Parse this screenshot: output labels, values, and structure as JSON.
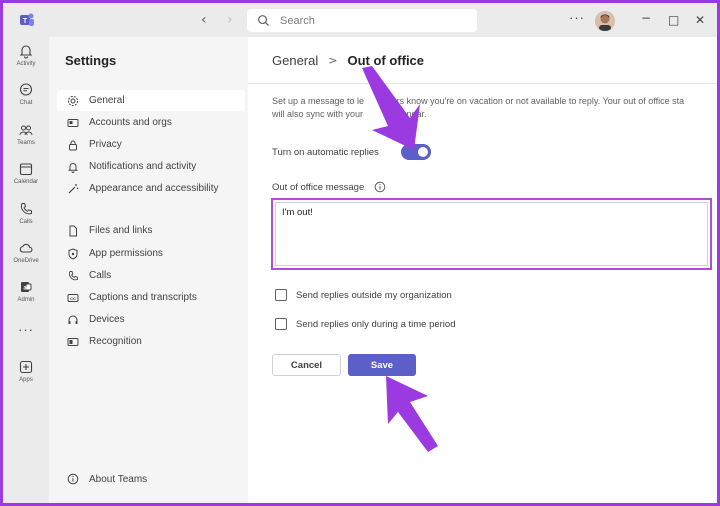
{
  "titlebar": {
    "search_placeholder": "Search",
    "more_label": "···",
    "minimize": "−",
    "maximize": "□",
    "close": "✕"
  },
  "rail": {
    "items": [
      {
        "label": "Activity",
        "icon": "bell-icon"
      },
      {
        "label": "Chat",
        "icon": "chat-icon"
      },
      {
        "label": "Teams",
        "icon": "teams-icon"
      },
      {
        "label": "Calendar",
        "icon": "calendar-icon"
      },
      {
        "label": "Calls",
        "icon": "phone-icon"
      },
      {
        "label": "OneDrive",
        "icon": "cloud-icon"
      },
      {
        "label": "Admin",
        "icon": "admin-icon"
      },
      {
        "label": "Apps",
        "icon": "apps-icon"
      }
    ],
    "more_label": "···"
  },
  "sidebar": {
    "title": "Settings",
    "items": [
      {
        "label": "General",
        "icon": "gear-icon",
        "active": true
      },
      {
        "label": "Accounts and orgs",
        "icon": "accounts-icon"
      },
      {
        "label": "Privacy",
        "icon": "lock-icon"
      },
      {
        "label": "Notifications and activity",
        "icon": "bell-icon"
      },
      {
        "label": "Appearance and accessibility",
        "icon": "magic-wand-icon"
      },
      {
        "label": "Files and links",
        "icon": "file-icon"
      },
      {
        "label": "App permissions",
        "icon": "shield-icon"
      },
      {
        "label": "Calls",
        "icon": "phone-icon"
      },
      {
        "label": "Captions and transcripts",
        "icon": "captions-icon"
      },
      {
        "label": "Devices",
        "icon": "headset-icon"
      },
      {
        "label": "Recognition",
        "icon": "recognition-icon"
      }
    ],
    "about_label": "About Teams"
  },
  "main": {
    "breadcrumb_parent": "General",
    "breadcrumb_sep": ">",
    "breadcrumb_current": "Out of office",
    "description_line1": "Set up a message to le      others know you're on vacation or not available to reply. Your out of office sta",
    "description_line2": "will also sync with your        k calendar.",
    "toggle_label": "Turn on automatic replies",
    "toggle_on": true,
    "message_label": "Out of office message",
    "message_value": "I'm out!",
    "checkbox_outside": "Send replies outside my organization",
    "checkbox_period": "Send replies only during a time period",
    "cancel_label": "Cancel",
    "save_label": "Save"
  },
  "colors": {
    "accent": "#5b5fc7",
    "annotation": "#9b3ae0",
    "sidebar_bg": "#f5f5f5",
    "rail_bg": "#ebebeb"
  }
}
